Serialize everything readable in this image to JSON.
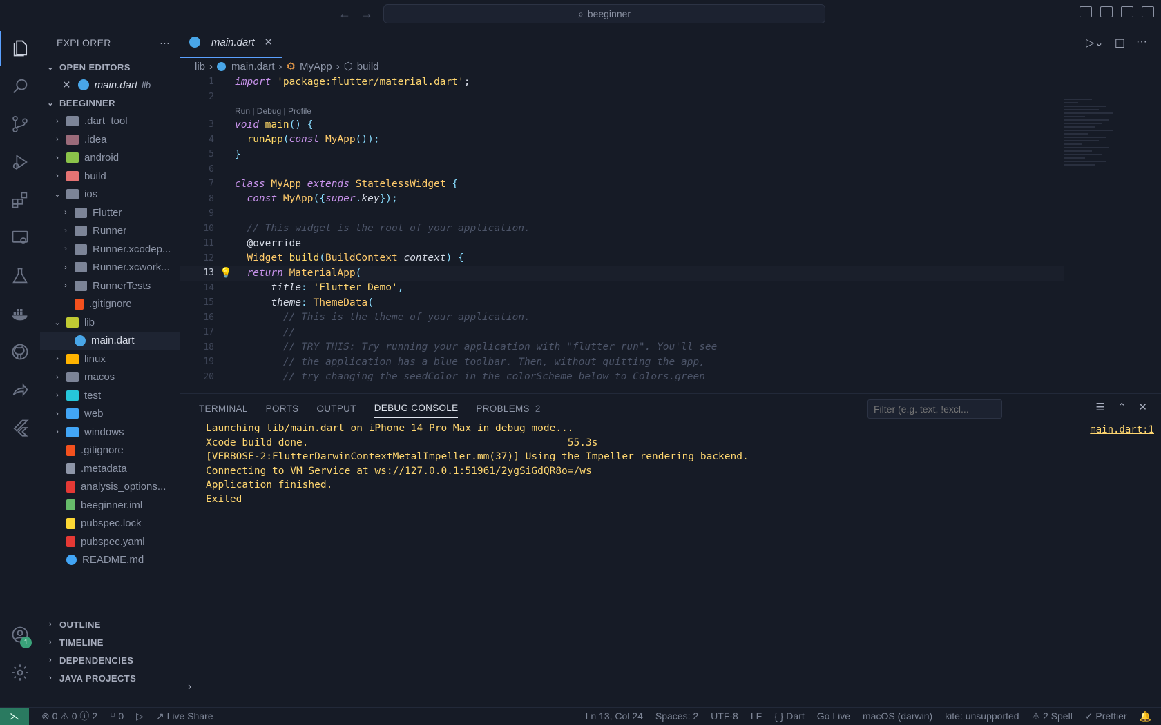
{
  "titlebar": {
    "search_text": "beeginner"
  },
  "activity_bar": {
    "items": [
      "files-icon",
      "search-icon",
      "source-control-icon",
      "run-debug-icon",
      "extensions-icon",
      "remote-explorer-icon",
      "testing-icon",
      "docker-icon",
      "github-icon",
      "live-share-icon",
      "flutter-icon"
    ],
    "account_badge": "1"
  },
  "sidebar": {
    "title": "EXPLORER",
    "open_editors_label": "OPEN EDITORS",
    "open_editor": {
      "name": "main.dart",
      "folder": "lib"
    },
    "project_label": "BEEGINNER",
    "tree": [
      {
        "name": ".dart_tool",
        "depth": 0,
        "type": "folder",
        "color": "#7c8497"
      },
      {
        "name": ".idea",
        "depth": 0,
        "type": "folder",
        "color": "#9b6b7a"
      },
      {
        "name": "android",
        "depth": 0,
        "type": "folder",
        "color": "#8bc34a"
      },
      {
        "name": "build",
        "depth": 0,
        "type": "folder",
        "color": "#e57373"
      },
      {
        "name": "ios",
        "depth": 0,
        "type": "folder-open",
        "color": "#7c8497"
      },
      {
        "name": "Flutter",
        "depth": 1,
        "type": "folder",
        "color": "#7c8497"
      },
      {
        "name": "Runner",
        "depth": 1,
        "type": "folder",
        "color": "#7c8497"
      },
      {
        "name": "Runner.xcodep...",
        "depth": 1,
        "type": "folder",
        "color": "#7c8497"
      },
      {
        "name": "Runner.xcwork...",
        "depth": 1,
        "type": "folder",
        "color": "#7c8497"
      },
      {
        "name": "RunnerTests",
        "depth": 1,
        "type": "folder",
        "color": "#7c8497"
      },
      {
        "name": ".gitignore",
        "depth": 1,
        "type": "git",
        "color": "#f4511e"
      },
      {
        "name": "lib",
        "depth": 0,
        "type": "folder-open",
        "color": "#c0ca33"
      },
      {
        "name": "main.dart",
        "depth": 1,
        "type": "dart",
        "color": "#49a6e8"
      },
      {
        "name": "linux",
        "depth": 0,
        "type": "folder",
        "color": "#ffb300"
      },
      {
        "name": "macos",
        "depth": 0,
        "type": "folder",
        "color": "#7c8497"
      },
      {
        "name": "test",
        "depth": 0,
        "type": "folder",
        "color": "#26c6da"
      },
      {
        "name": "web",
        "depth": 0,
        "type": "folder",
        "color": "#42a5f5"
      },
      {
        "name": "windows",
        "depth": 0,
        "type": "folder",
        "color": "#42a5f5"
      },
      {
        "name": ".gitignore",
        "depth": 0,
        "type": "git",
        "color": "#f4511e"
      },
      {
        "name": ".metadata",
        "depth": 0,
        "type": "file",
        "color": "#8e96a8"
      },
      {
        "name": "analysis_options...",
        "depth": 0,
        "type": "file",
        "color": "#e53935"
      },
      {
        "name": "beeginner.iml",
        "depth": 0,
        "type": "file",
        "color": "#66bb6a"
      },
      {
        "name": "pubspec.lock",
        "depth": 0,
        "type": "lock",
        "color": "#fdd835"
      },
      {
        "name": "pubspec.yaml",
        "depth": 0,
        "type": "file",
        "color": "#e53935"
      },
      {
        "name": "README.md",
        "depth": 0,
        "type": "info",
        "color": "#42a5f5"
      }
    ],
    "bottom_sections": [
      "OUTLINE",
      "TIMELINE",
      "DEPENDENCIES",
      "JAVA PROJECTS"
    ]
  },
  "editor": {
    "tab": "main.dart",
    "breadcrumb": [
      "lib",
      "main.dart",
      "MyApp",
      "build"
    ],
    "codelens": "Run | Debug | Profile",
    "current_line": "13"
  },
  "panel": {
    "tabs": [
      "TERMINAL",
      "PORTS",
      "OUTPUT",
      "DEBUG CONSOLE",
      "PROBLEMS"
    ],
    "active_tab": "DEBUG CONSOLE",
    "problems_count": "2",
    "filter_placeholder": "Filter (e.g. text, !excl...",
    "source_ref": "main.dart:1",
    "lines": [
      "Launching lib/main.dart on iPhone 14 Pro Max in debug mode...",
      "Xcode build done.                                           55.3s",
      "[VERBOSE-2:FlutterDarwinContextMetalImpeller.mm(37)] Using the Impeller rendering backend.",
      "Connecting to VM Service at ws://127.0.0.1:51961/2ygSiGdQR8o=/ws",
      "Application finished.",
      "Exited"
    ]
  },
  "statusbar": {
    "problems": "⊗ 0 ⚠ 0 ⓘ 2",
    "ports": "⑂ 0",
    "live_share": "Live Share",
    "position": "Ln 13, Col 24",
    "spaces": "Spaces: 2",
    "encoding": "UTF-8",
    "eol": "LF",
    "language": "{ } Dart",
    "go_live": "Go Live",
    "device": "macOS (darwin)",
    "kite": "kite: unsupported",
    "spell": "⚠ 2 Spell",
    "prettier": "✓ Prettier"
  }
}
